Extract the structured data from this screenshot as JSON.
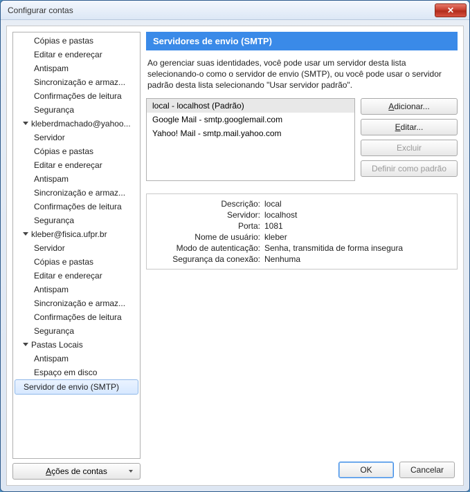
{
  "window": {
    "title": "Configurar contas"
  },
  "tree": {
    "account_group_0_items": [
      "Cópias e pastas",
      "Editar e endereçar",
      "Antispam",
      "Sincronização e armaz...",
      "Confirmações de leitura",
      "Segurança"
    ],
    "account_group_1_label": "kleberdmachado@yahoo...",
    "account_group_1_items": [
      "Servidor",
      "Cópias e pastas",
      "Editar e endereçar",
      "Antispam",
      "Sincronização e armaz...",
      "Confirmações de leitura",
      "Segurança"
    ],
    "account_group_2_label": "kleber@fisica.ufpr.br",
    "account_group_2_items": [
      "Servidor",
      "Cópias e pastas",
      "Editar e endereçar",
      "Antispam",
      "Sincronização e armaz...",
      "Confirmações de leitura",
      "Segurança"
    ],
    "account_group_3_label": "Pastas Locais",
    "account_group_3_items": [
      "Antispam",
      "Espaço em disco"
    ],
    "smtp_row": "Servidor de envio (SMTP)"
  },
  "actions_button": "Ações de contas",
  "panel": {
    "header": "Servidores de envio (SMTP)",
    "description": "Ao gerenciar suas identidades, você pode usar um servidor desta lista selecionando-o como o servidor de envio (SMTP), ou você pode usar o servidor padrão desta lista selecionando \"Usar servidor padrão\"."
  },
  "smtp_servers": [
    "local - localhost (Padrão)",
    "Google Mail - smtp.googlemail.com",
    "Yahoo! Mail - smtp.mail.yahoo.com"
  ],
  "buttons": {
    "add": "Adicionar...",
    "edit": "Editar...",
    "delete": "Excluir",
    "set_default": "Definir como padrão",
    "ok": "OK",
    "cancel": "Cancelar"
  },
  "details": {
    "labels": {
      "description": "Descrição:",
      "server": "Servidor:",
      "port": "Porta:",
      "username": "Nome de usuário:",
      "auth_mode": "Modo de autenticação:",
      "conn_security": "Segurança da conexão:"
    },
    "values": {
      "description": "local",
      "server": "localhost",
      "port": "1081",
      "username": "kleber",
      "auth_mode": "Senha, transmitida de forma insegura",
      "conn_security": "Nenhuma"
    }
  }
}
